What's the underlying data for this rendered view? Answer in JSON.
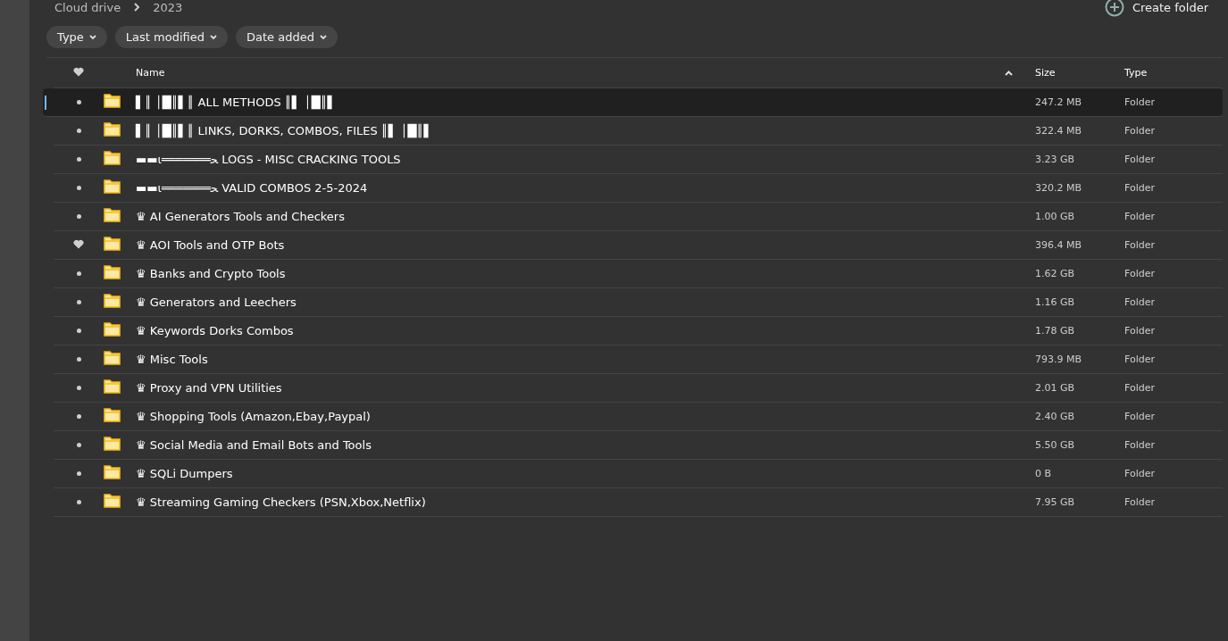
{
  "breadcrumb": [
    "Cloud drive",
    "2023"
  ],
  "create_folder": "Create folder",
  "filters": [
    "Type",
    "Last modified",
    "Date added"
  ],
  "table": {
    "columns": {
      "name": "Name",
      "size": "Size",
      "type": "Type"
    },
    "rows": [
      {
        "name": "▌║ │█║▌║ ALL METHODS ║▌ │█║▌",
        "size": "247.2 MB",
        "type": "Folder",
        "favorite": false,
        "selected": true
      },
      {
        "name": "▌║ │█║▌║ LINKS, DORKS, COMBOS, FILES ║▌ │█║▌",
        "size": "322.4 MB",
        "type": "Folder",
        "favorite": false,
        "selected": false
      },
      {
        "name": "▬▬ι═══════ﺤ LOGS - MISC CRACKING TOOLS",
        "size": "3.23 GB",
        "type": "Folder",
        "favorite": false,
        "selected": false
      },
      {
        "name": "▬▬ι═══════ﺤ VALID COMBOS 2-5-2024",
        "size": "320.2 MB",
        "type": "Folder",
        "favorite": false,
        "selected": false
      },
      {
        "name": "♛ AI Generators Tools and Checkers",
        "size": "1.00 GB",
        "type": "Folder",
        "favorite": false,
        "selected": false
      },
      {
        "name": "♛ AOI Tools and OTP Bots",
        "size": "396.4 MB",
        "type": "Folder",
        "favorite": true,
        "selected": false
      },
      {
        "name": "♛ Banks and Crypto Tools",
        "size": "1.62 GB",
        "type": "Folder",
        "favorite": false,
        "selected": false
      },
      {
        "name": "♛ Generators and Leechers",
        "size": "1.16 GB",
        "type": "Folder",
        "favorite": false,
        "selected": false
      },
      {
        "name": "♛ Keywords Dorks Combos",
        "size": "1.78 GB",
        "type": "Folder",
        "favorite": false,
        "selected": false
      },
      {
        "name": "♛ Misc Tools",
        "size": "793.9 MB",
        "type": "Folder",
        "favorite": false,
        "selected": false
      },
      {
        "name": "♛ Proxy and VPN Utilities",
        "size": "2.01 GB",
        "type": "Folder",
        "favorite": false,
        "selected": false
      },
      {
        "name": "♛ Shopping Tools (Amazon,Ebay,Paypal)",
        "size": "2.40 GB",
        "type": "Folder",
        "favorite": false,
        "selected": false
      },
      {
        "name": "♛ Social Media and Email Bots and Tools",
        "size": "5.50 GB",
        "type": "Folder",
        "favorite": false,
        "selected": false
      },
      {
        "name": "♛ SQLi Dumpers",
        "size": "0 B",
        "type": "Folder",
        "favorite": false,
        "selected": false
      },
      {
        "name": "♛ Streaming Gaming Checkers (PSN,Xbox,Netflix)",
        "size": "7.95 GB",
        "type": "Folder",
        "favorite": false,
        "selected": false
      }
    ]
  }
}
